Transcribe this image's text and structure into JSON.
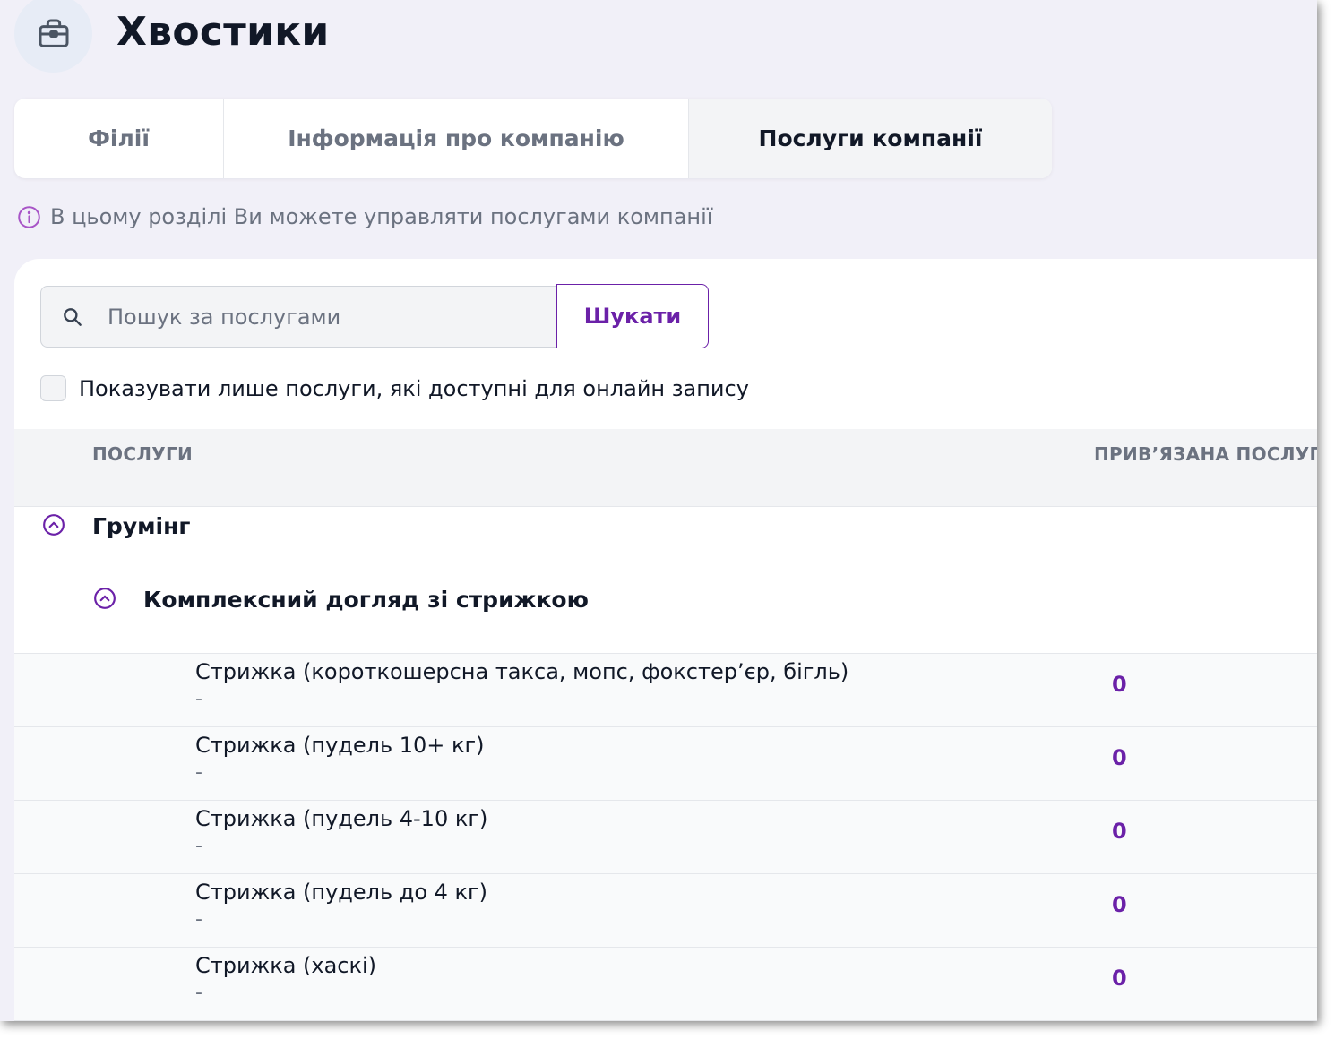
{
  "company": {
    "name": "Хвостики",
    "logo_icon": "briefcase-icon"
  },
  "tabs": [
    {
      "label": "Філії",
      "active": false
    },
    {
      "label": "Інформація про компанію",
      "active": false
    },
    {
      "label": "Послуги компанії",
      "active": true
    }
  ],
  "info": {
    "icon": "info-icon",
    "text": "В цьому розділі Ви можете управляти послугами компанії"
  },
  "search": {
    "icon": "search-icon",
    "placeholder": "Пошук за послугами",
    "value": "",
    "button_label": "Шукати"
  },
  "filter": {
    "label": "Показувати лише послуги, які доступні для онлайн запису",
    "checked": false
  },
  "table": {
    "headers": {
      "services": "ПОСЛУГИ",
      "linked": "ПРИВ’ЯЗАНА ПОСЛУГА"
    },
    "category": {
      "label": "Грумінг",
      "expanded": true
    },
    "subcategory": {
      "label": "Комплексний догляд зі стрижкою",
      "expanded": true
    },
    "services": [
      {
        "name": "Стрижка (короткошерсна такса, мопс, фокстер’єр, бігль)",
        "sub": "-",
        "count": "0"
      },
      {
        "name": "Стрижка (пудель 10+ кг)",
        "sub": "-",
        "count": "0"
      },
      {
        "name": "Стрижка (пудель 4-10 кг)",
        "sub": "-",
        "count": "0"
      },
      {
        "name": "Стрижка (пудель до 4 кг)",
        "sub": "-",
        "count": "0"
      },
      {
        "name": "Стрижка (хаскі)",
        "sub": "-",
        "count": "0"
      }
    ]
  },
  "colors": {
    "accent": "#6b21a8",
    "background": "#f1f0f8",
    "muted_text": "#6b7280"
  }
}
